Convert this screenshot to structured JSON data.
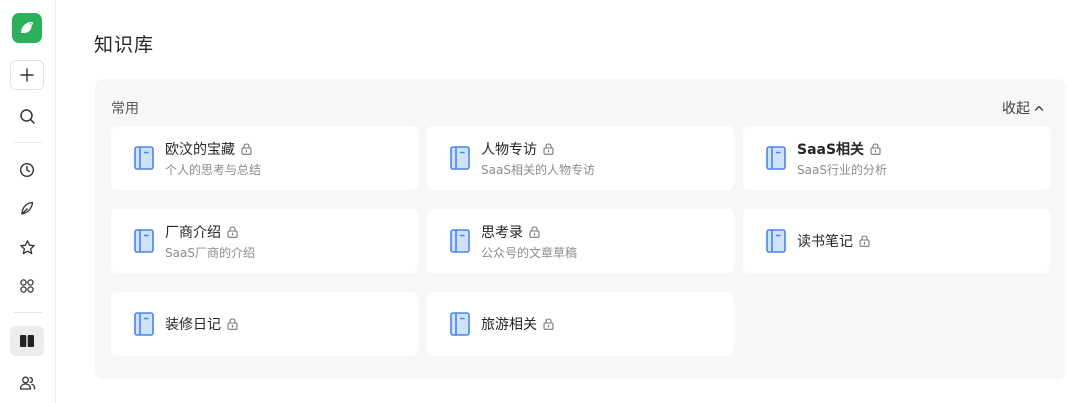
{
  "page": {
    "title": "知识库"
  },
  "sidebar": {
    "logo_icon": "yuque-bird-logo-icon",
    "items": [
      {
        "name": "new",
        "icon": "plus-icon"
      },
      {
        "name": "search",
        "icon": "search-icon"
      },
      {
        "name": "recent",
        "icon": "clock-icon"
      },
      {
        "name": "notes",
        "icon": "feather-icon"
      },
      {
        "name": "favorites",
        "icon": "star-icon"
      },
      {
        "name": "apps",
        "icon": "apps-icon"
      },
      {
        "name": "library",
        "icon": "book-open-icon",
        "active": true
      },
      {
        "name": "team",
        "icon": "users-icon"
      }
    ]
  },
  "section": {
    "label": "常用",
    "collapse_label": "收起",
    "collapse_icon": "chevron-up-icon"
  },
  "books": [
    {
      "name": "欧汶的宝藏",
      "desc": "个人的思考与总结",
      "bold": false
    },
    {
      "name": "人物专访",
      "desc": "SaaS相关的人物专访",
      "bold": false
    },
    {
      "name": "SaaS相关",
      "desc": "SaaS行业的分析",
      "bold": true
    },
    {
      "name": "厂商介绍",
      "desc": "SaaS厂商的介绍",
      "bold": false
    },
    {
      "name": "思考录",
      "desc": "公众号的文章草稿",
      "bold": false
    },
    {
      "name": "读书笔记",
      "desc": "",
      "bold": false
    },
    {
      "name": "装修日记",
      "desc": "",
      "bold": false
    },
    {
      "name": "旅游相关",
      "desc": "",
      "bold": false
    }
  ],
  "colors": {
    "brand": "#2bb15a",
    "book_icon_fill": "#cfe2fb",
    "book_icon_stroke": "#4a86e8",
    "panel_bg": "#f7f7f7"
  }
}
